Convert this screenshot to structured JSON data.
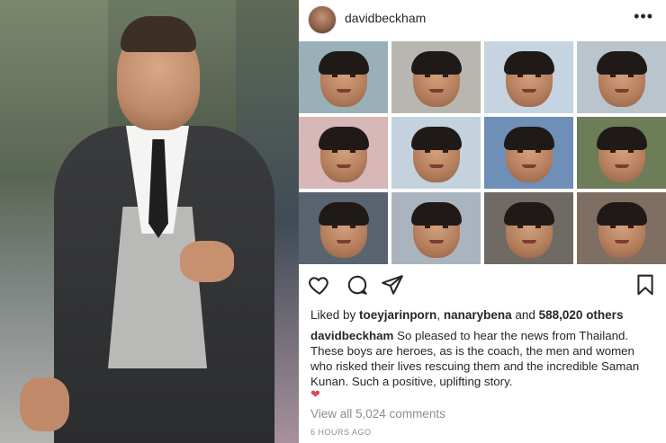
{
  "header": {
    "username": "davidbeckham",
    "more_icon": "•••"
  },
  "grid": {
    "tiles": [
      {
        "bg": "#9ab0b8"
      },
      {
        "bg": "#b8b6b1"
      },
      {
        "bg": "#c6d4e1"
      },
      {
        "bg": "#b9c4cc"
      },
      {
        "bg": "#d7b7b7"
      },
      {
        "bg": "#c3d2dd"
      },
      {
        "bg": "#6e8fb7"
      },
      {
        "bg": "#6c7d57"
      },
      {
        "bg": "#5a6370"
      },
      {
        "bg": "#aab4bf"
      },
      {
        "bg": "#6f6a64"
      },
      {
        "bg": "#7f6f63"
      }
    ]
  },
  "actions": {
    "like_icon": "heart-outline",
    "comment_icon": "speech-bubble",
    "share_icon": "paper-plane",
    "save_icon": "bookmark"
  },
  "likes": {
    "prefix": "Liked by ",
    "user1": "toeyjarinporn",
    "sep": ", ",
    "user2": "nanarybena",
    "and": " and ",
    "count": "588,020 others"
  },
  "caption": {
    "username": "davidbeckham",
    "text": " So pleased to hear the news from Thailand. These boys are heroes, as is the coach, the men and women who risked their lives rescuing them and the incredible Saman Kunan. Such a positive, uplifting story."
  },
  "emoji": "❤",
  "comments_link": "View all 5,024 comments",
  "timestamp": "6 HOURS AGO",
  "colors": {
    "text": "#262626",
    "muted": "#8e8e8e",
    "heart": "#e0485b"
  }
}
